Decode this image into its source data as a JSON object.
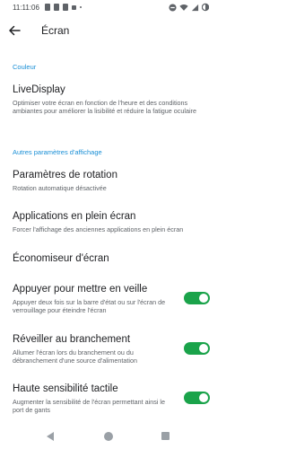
{
  "status_bar": {
    "time": "11:11:06"
  },
  "header": {
    "title": "Écran"
  },
  "sections": {
    "color": "Couleur",
    "other": "Autres paramètres d'affichage"
  },
  "items": {
    "livedisplay": {
      "title": "LiveDisplay",
      "summary": "Optimiser votre écran en fonction de l'heure et des conditions ambiantes pour améliorer la lisibilité et réduire la fatigue oculaire"
    },
    "rotation": {
      "title": "Paramètres de rotation",
      "summary": "Rotation automatique désactivée"
    },
    "fullscreen": {
      "title": "Applications en plein écran",
      "summary": "Forcer l'affichage des anciennes applications en plein écran"
    },
    "screensaver": {
      "title": "Économiseur d'écran"
    },
    "tap_to_sleep": {
      "title": "Appuyer pour mettre en veille",
      "summary": "Appuyer deux fois sur la barre d'état ou sur l'écran de verrouillage pour éteindre l'écran",
      "enabled": true
    },
    "wake_on_plug": {
      "title": "Réveiller au branchement",
      "summary": "Allumer l'écran lors du branchement ou du débranchement d'une source d'alimentation",
      "enabled": true
    },
    "high_touch": {
      "title": "Haute sensibilité tactile",
      "summary": "Augmenter la sensibilité de l'écran permettant ainsi le port de gants",
      "enabled": true
    }
  },
  "colors": {
    "accent": "#1a8fd6",
    "toggle_on": "#1aa34a"
  }
}
